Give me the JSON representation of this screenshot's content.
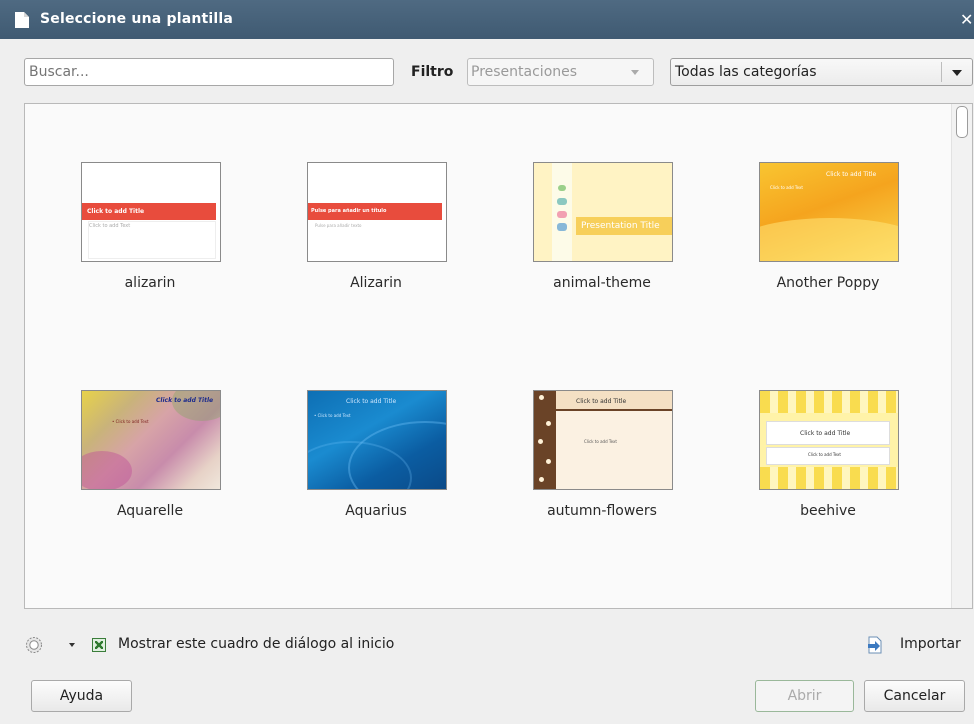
{
  "window": {
    "title": "Seleccione una plantilla",
    "close_glyph": "✕"
  },
  "toolbar": {
    "search_placeholder": "Buscar...",
    "filter_label": "Filtro",
    "filter_value": "Presentaciones",
    "category_value": "Todas las categorías"
  },
  "templates": [
    {
      "label": "alizarin",
      "title_text": "Click to add Title",
      "body_text": "Click to add Text"
    },
    {
      "label": "Alizarin",
      "title_text": "Pulse para añadir un título",
      "body_text": "Pulse para añadir texto"
    },
    {
      "label": "animal-theme",
      "title_text": "Presentation Title"
    },
    {
      "label": "Another Poppy",
      "title_text": "Click to add Title",
      "body_text": "Click to add Text"
    },
    {
      "label": "Aquarelle",
      "title_text": "Click to add Title",
      "body_text": "• Click to add Text"
    },
    {
      "label": "Aquarius",
      "title_text": "Click to add Title",
      "body_text": "• Click to add Text"
    },
    {
      "label": "autumn-flowers",
      "title_text": "Click to add Title",
      "body_text": "Click to add Text"
    },
    {
      "label": "beehive",
      "title_text": "Click to add Title",
      "body_text": "Click to add Text"
    }
  ],
  "footer": {
    "show_on_start_label": "Mostrar este cuadro de diálogo al inicio",
    "show_on_start_checked": true,
    "import_label": "Importar",
    "help_button": "Ayuda",
    "open_button": "Abrir",
    "cancel_button": "Cancelar"
  },
  "icons": {
    "document": "document-icon",
    "gear": "gear-icon",
    "import": "import-icon"
  }
}
